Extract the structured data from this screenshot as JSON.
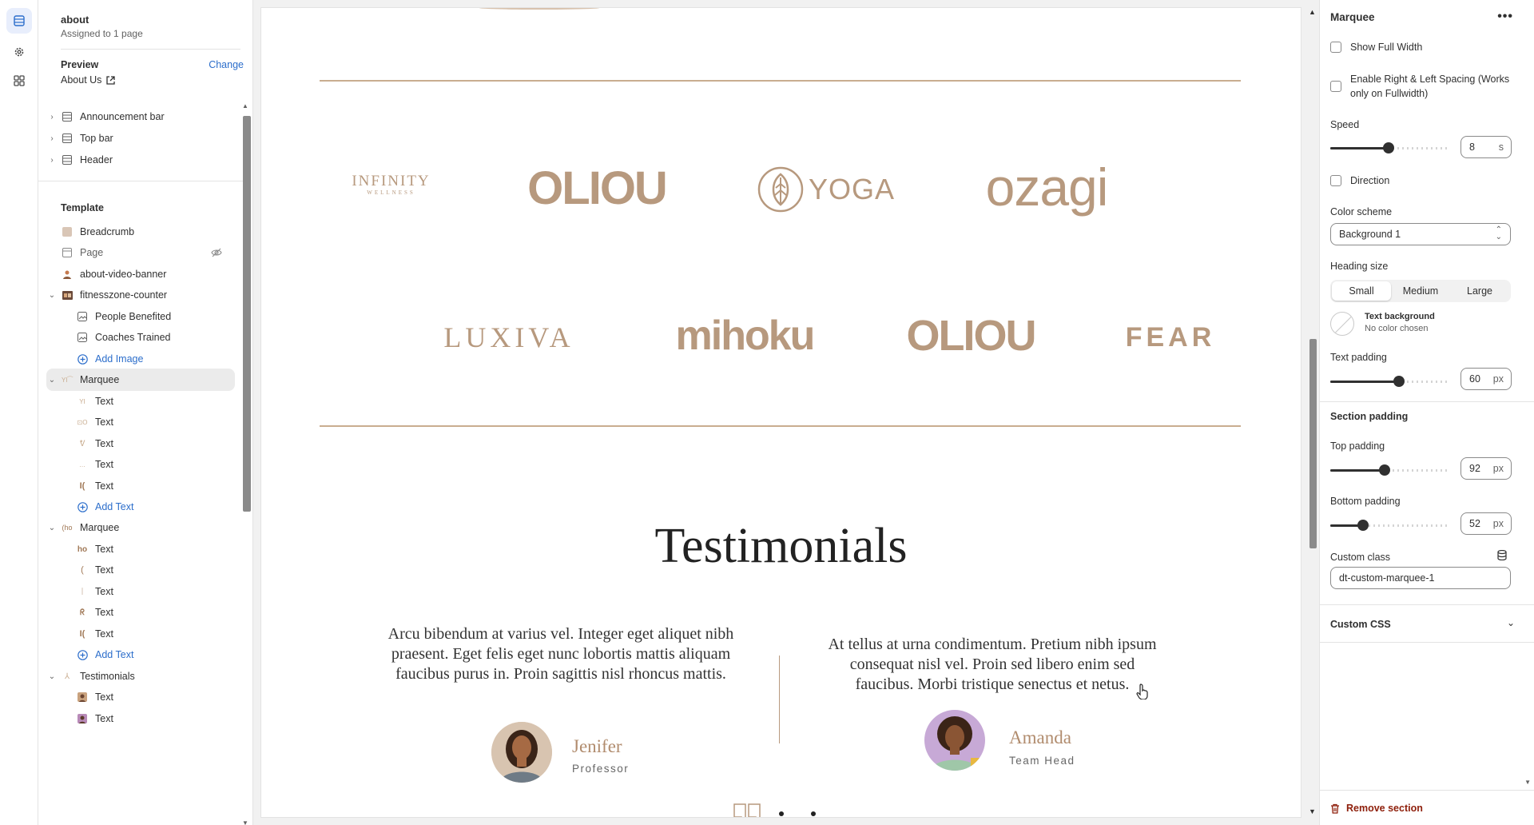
{
  "sidebar": {
    "title": "about",
    "subtitle": "Assigned to 1 page",
    "preview_label": "Preview",
    "change_label": "Change",
    "preview_value": "About Us",
    "items": [
      {
        "label": "Announcement bar"
      },
      {
        "label": "Top bar"
      },
      {
        "label": "Header"
      },
      {
        "label": "Template"
      },
      {
        "label": "Breadcrumb"
      },
      {
        "label": "Page"
      },
      {
        "label": "about-video-banner"
      },
      {
        "label": "fitnesszone-counter"
      },
      {
        "label": "People Benefited"
      },
      {
        "label": "Coaches Trained"
      },
      {
        "label": "Add Image"
      },
      {
        "label": "Marquee"
      },
      {
        "label": "Text"
      },
      {
        "label": "Text"
      },
      {
        "label": "Text"
      },
      {
        "label": "Text"
      },
      {
        "label": "Text"
      },
      {
        "label": "Add Text"
      },
      {
        "label": "Marquee"
      },
      {
        "label": "Text"
      },
      {
        "label": "Text"
      },
      {
        "label": "Text"
      },
      {
        "label": "Text"
      },
      {
        "label": "Text"
      },
      {
        "label": "Add Text"
      },
      {
        "label": "Testimonials"
      },
      {
        "label": "Text"
      },
      {
        "label": "Text"
      }
    ]
  },
  "canvas": {
    "logos_row1": [
      "INFINITY",
      "WELLNESS",
      "OLIOU",
      "YOGA",
      "ozagi"
    ],
    "logos_row2": [
      "LUXIVA",
      "mihoku",
      "OLIOU",
      "FEAR"
    ],
    "testimonials_title": "Testimonials",
    "testimonials": [
      {
        "quote": "Arcu bibendum at varius vel. Integer eget aliquet nibh praesent. Eget felis eget nunc lobortis mattis aliquam faucibus purus in. Proin sagittis nisl rhoncus mattis.",
        "name": "Jenifer",
        "role": "Professor"
      },
      {
        "quote": "At tellus at urna condimentum. Pretium nibh ipsum consequat nisl vel. Proin sed libero enim sed faucibus. Morbi tristique senectus et netus.",
        "name": "Amanda",
        "role": "Team Head"
      }
    ]
  },
  "panel": {
    "title": "Marquee",
    "more": "•••",
    "show_full_width": "Show Full Width",
    "enable_spacing": "Enable Right & Left Spacing (Works only on Fullwidth)",
    "speed_label": "Speed",
    "speed_value": "8",
    "speed_unit": "s",
    "speed_fraction": 0.5,
    "direction_label": "Direction",
    "color_scheme_label": "Color scheme",
    "color_scheme_value": "Background 1",
    "heading_size_label": "Heading size",
    "heading_sizes": [
      "Small",
      "Medium",
      "Large"
    ],
    "heading_size_selected": "Small",
    "text_bg_label": "Text background",
    "text_bg_value": "No color chosen",
    "text_padding_label": "Text padding",
    "text_padding_value": "60",
    "text_padding_unit": "px",
    "text_padding_fraction": 0.6,
    "section_padding_label": "Section padding",
    "top_padding_label": "Top padding",
    "top_padding_value": "92",
    "top_padding_unit": "px",
    "top_padding_fraction": 0.46,
    "bottom_padding_label": "Bottom padding",
    "bottom_padding_value": "52",
    "bottom_padding_unit": "px",
    "bottom_padding_fraction": 0.26,
    "custom_class_label": "Custom class",
    "custom_class_value": "dt-custom-marquee-1",
    "custom_css_label": "Custom CSS",
    "remove_label": "Remove section"
  },
  "colors": {
    "accent": "#2c6ecb",
    "gold": "#b7997e",
    "danger": "#8e1f0b"
  }
}
